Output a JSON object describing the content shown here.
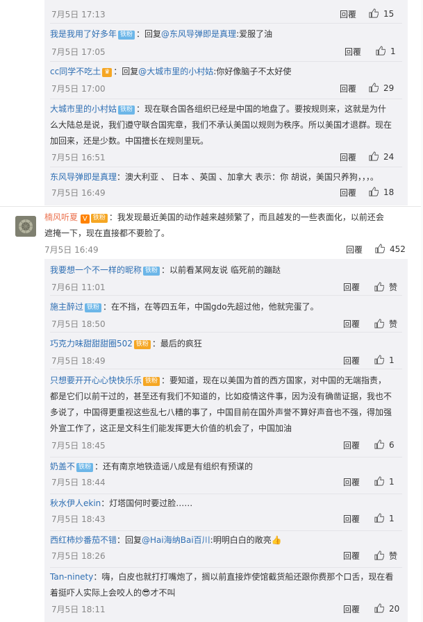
{
  "labels": {
    "reply": "回覆"
  },
  "top_replies": [
    {
      "time": "7月5日 17:13",
      "likes": "15"
    },
    {
      "nick": "我是我用了好多年",
      "badge": "铁粉",
      "pre": "：回复",
      "at": "@东风导弹即是真理",
      "text": ":爱服了油",
      "time": "7月5日 17:05",
      "likes": "1"
    },
    {
      "nick": "cc同学不吃土",
      "pre": "：回复",
      "at": "@大城市里的小村姑",
      "text": ":你好像脑子不太好使",
      "time": "7月5日 17:00",
      "likes": "29"
    },
    {
      "nick": "大城市里的小村姑",
      "badge": "铁粉",
      "lines": [
        "：现在联合国各组织已经是中国的地盘了。要按规则来，这就是为什",
        "么大陆总是说，我们遵守联合国宪章，我们不承认美国以规则为秩序。所以美国才退群。现在",
        "加回来，还是少数。中国擅长在规则里玩。"
      ],
      "time": "7月5日 16:51",
      "likes": "24"
    },
    {
      "nick": "东风导弹即是真理",
      "text": "：澳大利亚 、 日本 、英国 、加拿大  表示：你 胡说，美国只养狗，，，。",
      "time": "7月5日 16:49",
      "likes": "18"
    }
  ],
  "main_comment": {
    "nick": "楠风听夏",
    "vip_label": "铁粉",
    "lines": [
      "：我发现最近美国的动作越来越频繁了，而且越发的一些表面化，以前还会",
      "遮掩一下，现在直接都不要脸了。"
    ],
    "time": "7月5日 16:49",
    "likes": "452"
  },
  "sub_replies": [
    {
      "nick": "我要想一个不一样的昵称",
      "badge": "铁粉",
      "text": "：以前看某网友说 临死前的蹦跶",
      "time": "7月6日 11:01",
      "likes": "赞"
    },
    {
      "nick": "施主醉过",
      "badge": "铁粉",
      "text": "：在不挡，在等四五年，中国gdo先超过他，他就完蛋了。",
      "time": "7月5日 18:50",
      "likes": "赞"
    },
    {
      "nick": "巧克力味甜甜甜圈502",
      "vip": "铁粉",
      "text": "：最后的疯狂",
      "time": "7月5日 18:49",
      "likes": "1"
    },
    {
      "nick": "只想要开开心心快快乐乐",
      "vip": "铁粉",
      "lines": [
        "：要知道，现在以美国为首的西方国家，对中国的无端指责，",
        "都是它们以前干过的，甚至还有我们不知道的，比如疫情这件事，因为没有确凿证据，我也不",
        "多说了，中国得更重视这些乱七八糟的事了，中国目前在国外声誉不算好声音也不强，得加强",
        "外宣工作了，这正是文科生们能发挥更大价值的机会了，中国加油"
      ],
      "time": "7月5日 18:45",
      "likes": "6"
    },
    {
      "nick": "奶盖不",
      "badge": "铁粉",
      "text": "：还有南京地铁造谣八成是有组织有预谋的",
      "time": "7月5日 18:44",
      "likes": "1"
    },
    {
      "nick": "秋水伊人ekin",
      "text": "：灯塔国何时要过脸……",
      "time": "7月5日 18:43",
      "likes": "1"
    },
    {
      "nick": "西红柿炒番茄不错",
      "pre": "：回复",
      "at": "@Hai海纳Bai百川",
      "text": ":明明白白的敞亮👍",
      "time": "7月5日 18:26",
      "likes": "赞"
    },
    {
      "nick": "Tan-ninety",
      "lines": [
        "：嗨，白皮也就打打嘴炮了，搁以前直接炸使馆截货船还跟你费那个口舌，现在看",
        "着挺吓人实际上会咬人的😎才不叫"
      ],
      "time": "7月5日 18:11",
      "likes": "20"
    }
  ],
  "colors": {
    "nick": "#eb7350",
    "link": "#2f6fb3",
    "badge": "#6cb6e8",
    "vip": "#f5a623",
    "reply_bg": "#f2f2f5"
  }
}
